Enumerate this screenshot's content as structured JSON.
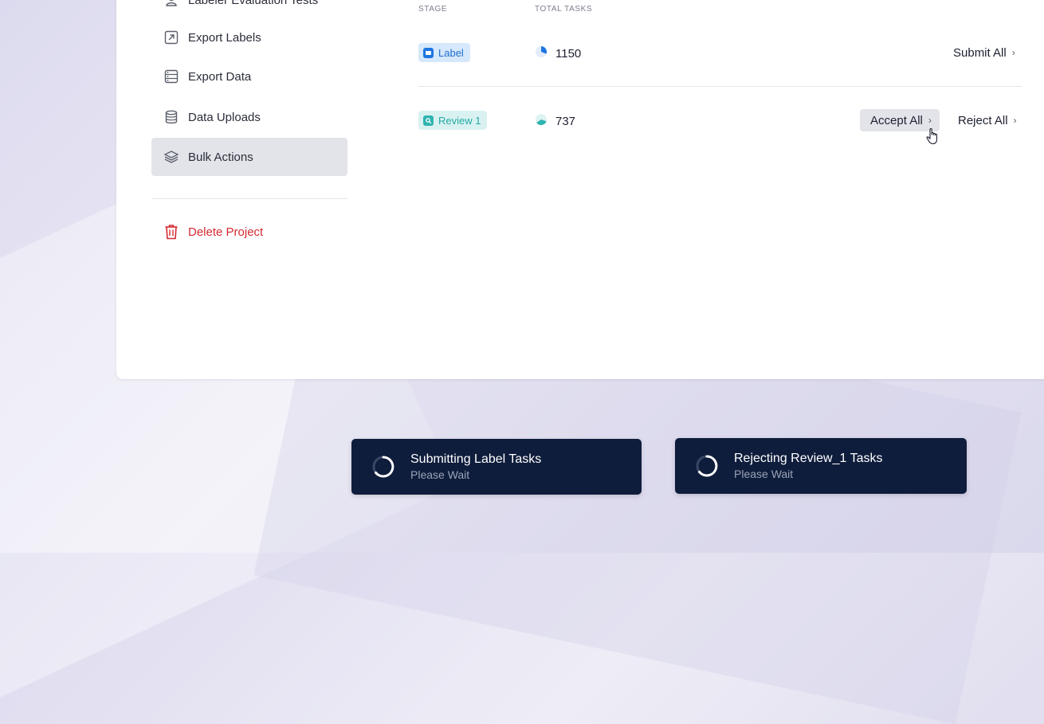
{
  "sidebar": {
    "items": [
      {
        "label": "Labeler Evaluation Tests",
        "icon": "user-icon"
      },
      {
        "label": "Export Labels",
        "icon": "export-icon"
      },
      {
        "label": "Export Data",
        "icon": "list-icon"
      },
      {
        "label": "Data Uploads",
        "icon": "database-icon"
      },
      {
        "label": "Bulk Actions",
        "icon": "layers-icon",
        "active": true
      }
    ],
    "delete_label": "Delete Project"
  },
  "table": {
    "columns": [
      "STAGE",
      "TOTAL TASKS"
    ],
    "rows": [
      {
        "stage": "Label",
        "total": "1150",
        "actions": [
          "Submit All"
        ]
      },
      {
        "stage": "Review 1",
        "total": "737",
        "actions": [
          "Accept All",
          "Reject All"
        ]
      }
    ]
  },
  "toasts": [
    {
      "title": "Submitting Label Tasks",
      "subtitle": "Please Wait"
    },
    {
      "title": "Rejecting Review_1 Tasks",
      "subtitle": "Please Wait"
    }
  ],
  "colors": {
    "accent_blue": "#1f75e0",
    "accent_teal": "#2fb4b0",
    "danger": "#d42a32",
    "toast_bg": "#0f1d3c"
  }
}
